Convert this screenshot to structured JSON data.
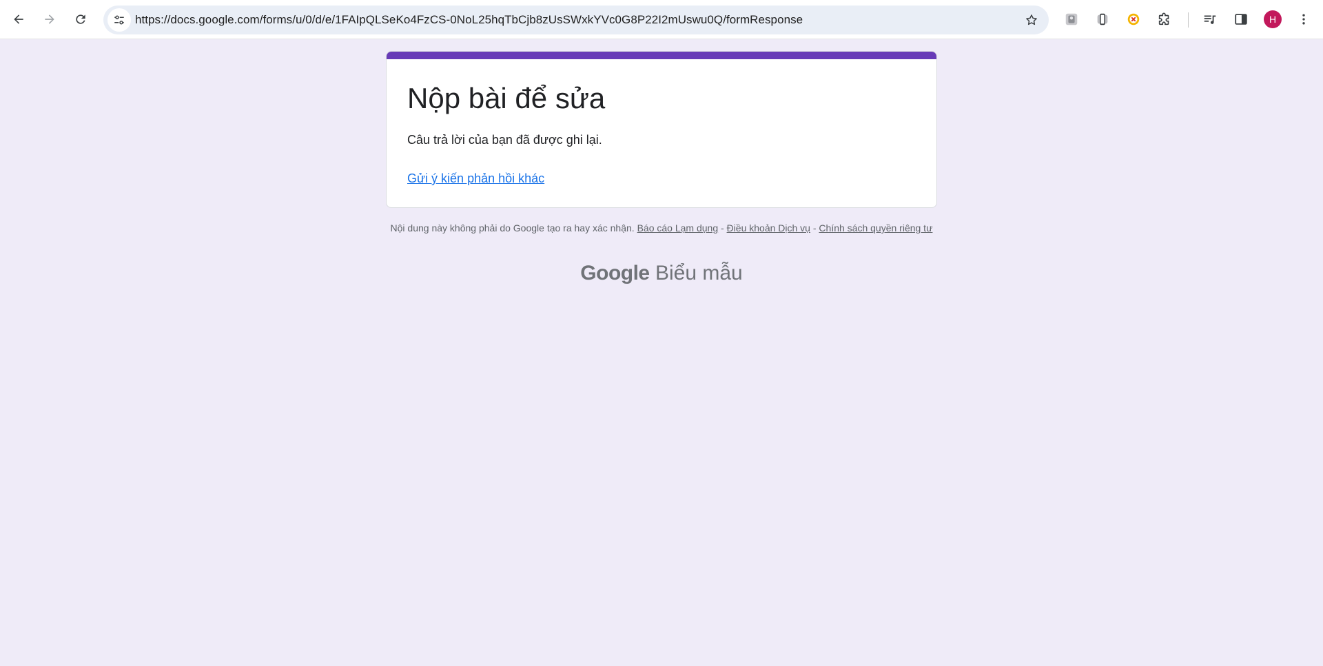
{
  "browser": {
    "url": "https://docs.google.com/forms/u/0/d/e/1FAIpQLSeKo4FzCS-0NoL25hqTbCjb8zUsSWxkYVc0G8P22I2mUswu0Q/formResponse",
    "icons": [
      "back-arrow-icon",
      "forward-arrow-icon",
      "reload-icon",
      "site-settings-icon",
      "bookmark-star-icon",
      "extension-icon",
      "media-controls-icon",
      "side-panel-icon",
      "kebab-menu-icon"
    ],
    "profile_initial": "H",
    "profile_color": "#c2185b"
  },
  "form": {
    "title": "Nộp bài để sửa",
    "confirmation": "Câu trả lời của bạn đã được ghi lại.",
    "submit_another_link": "Gửi ý kiến phản hồi khác",
    "accent_color": "#673ab7"
  },
  "footer": {
    "disclaimer": "Nội dung này không phải do Google tạo ra hay xác nhận.",
    "report_abuse": "Báo cáo Lạm dụng",
    "separator": "-",
    "terms": "Điều khoản Dịch vụ",
    "privacy": "Chính sách quyền riêng tư",
    "brand_google": "Google",
    "brand_product": "Biểu mẫu"
  },
  "colors": {
    "page_background": "#efebf8",
    "link": "#1a73e8"
  }
}
